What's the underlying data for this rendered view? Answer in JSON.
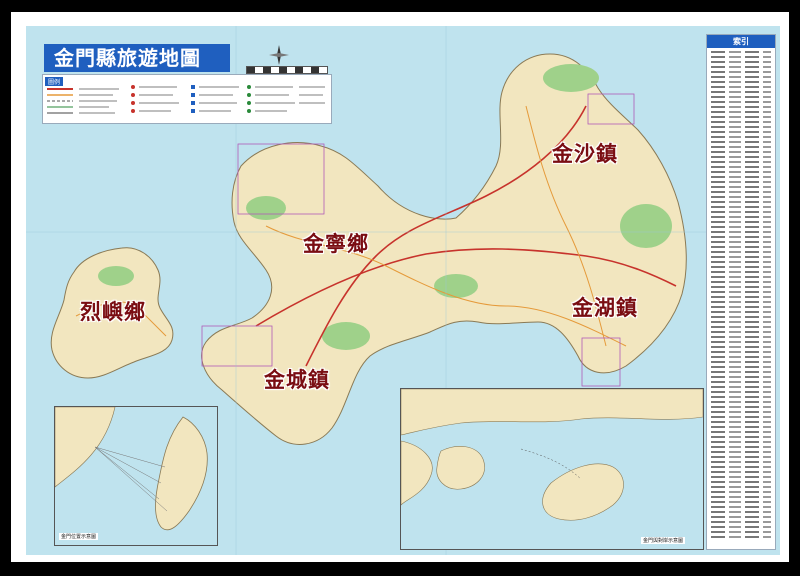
{
  "map": {
    "title": "金門縣旅遊地圖",
    "legend_heading": "圖例",
    "index_heading": "索引",
    "colors": {
      "sea": "#bfe3ee",
      "land": "#f2e6bf",
      "forest": "#9fd18a",
      "road_major": "#c7332c",
      "road_minor": "#e59a3a",
      "town_label": "#7a0d12",
      "accent": "#1f5fbf"
    }
  },
  "towns": [
    {
      "id": "jinsha",
      "name": "金沙鎮"
    },
    {
      "id": "jinning",
      "name": "金寧鄉"
    },
    {
      "id": "lieyu",
      "name": "烈嶼鄉"
    },
    {
      "id": "jinhu",
      "name": "金湖鎮"
    },
    {
      "id": "jincheng",
      "name": "金城鎮"
    }
  ],
  "insets": [
    {
      "id": "taiwan",
      "caption": "金門位置示意圖"
    },
    {
      "id": "xiamen",
      "caption": "金門與對岸示意圖"
    }
  ],
  "icons": [
    "compass-rose-icon",
    "scale-bar-icon"
  ]
}
